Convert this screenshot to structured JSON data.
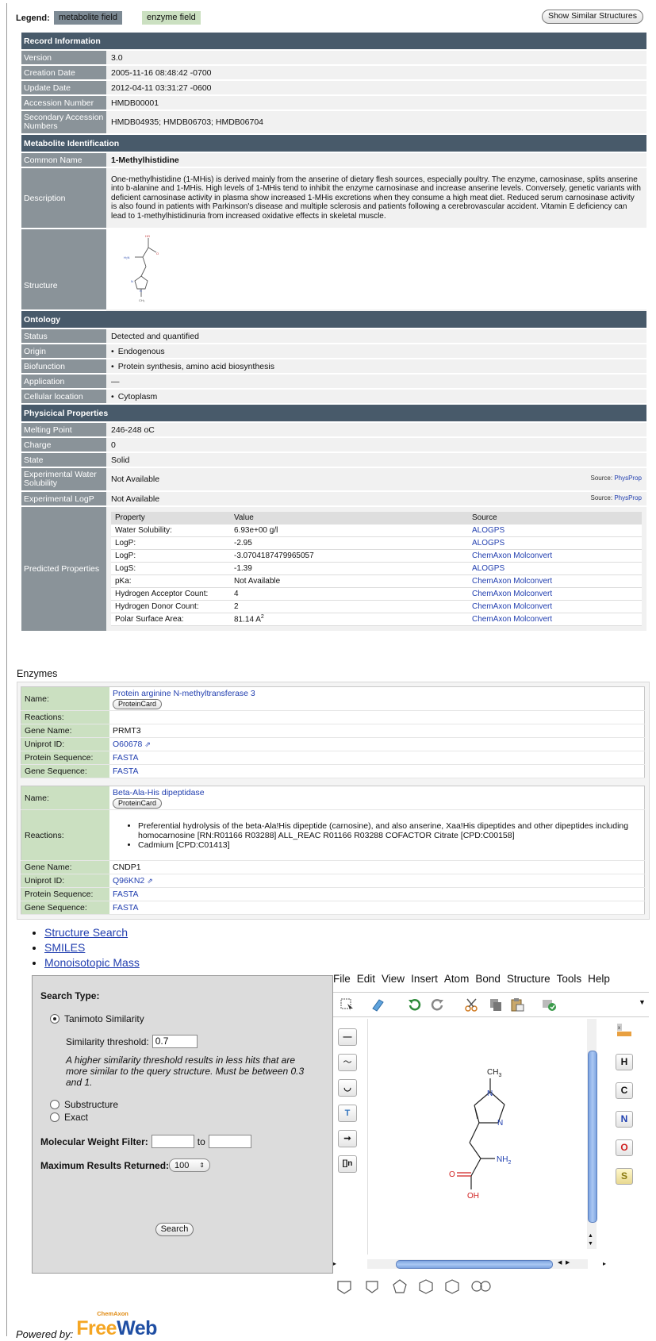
{
  "legend": {
    "label": "Legend:",
    "metabolite": "metabolite field",
    "enzyme": "enzyme field",
    "similar_button": "Show Similar Structures"
  },
  "record": {
    "section_record": "Record Information",
    "version_k": "Version",
    "version_v": "3.0",
    "creation_k": "Creation Date",
    "creation_v": "2005-11-16 08:48:42 -0700",
    "update_k": "Update Date",
    "update_v": "2012-04-11 03:31:27 -0600",
    "accession_k": "Accession Number",
    "accession_v": "HMDB00001",
    "secondary_k": "Secondary Accession Numbers",
    "secondary_v": "HMDB04935; HMDB06703; HMDB06704",
    "section_ident": "Metabolite Identification",
    "common_k": "Common Name",
    "common_v": "1-Methylhistidine",
    "description_k": "Description",
    "description_v": "One-methylhistidine (1-MHis) is derived mainly from the anserine of dietary flesh sources, especially poultry. The enzyme, carnosinase, splits anserine into b-alanine and 1-MHis. High levels of 1-MHis tend to inhibit the enzyme carnosinase and increase anserine levels. Conversely, genetic variants with deficient carnosinase activity in plasma show increased 1-MHis excretions when they consume a high meat diet. Reduced serum carnosinase activity is also found in patients with Parkinson's disease and multiple sclerosis and patients following a cerebrovascular accident. Vitamin E deficiency can lead to 1-methylhistidinuria from increased oxidative effects in skeletal muscle.",
    "structure_k": "Structure",
    "section_ontology": "Ontology",
    "status_k": "Status",
    "status_v": "Detected and quantified",
    "origin_k": "Origin",
    "origin_v": "Endogenous",
    "biofunction_k": "Biofunction",
    "biofunction_v": "Protein synthesis, amino acid biosynthesis",
    "application_k": "Application",
    "application_v": "—",
    "cellular_k": "Cellular location",
    "cellular_v": "Cytoplasm",
    "section_physical": "Physicical Properties",
    "melting_k": "Melting Point",
    "melting_v": "246-248 oC",
    "charge_k": "Charge",
    "charge_v": "0",
    "state_k": "State",
    "state_v": "Solid",
    "water_k": "Experimental Water Solubility",
    "water_v": "Not Available",
    "logp_k": "Experimental LogP",
    "logp_v": "Not Available",
    "source_label": "Source:",
    "source_link": "PhysProp",
    "predicted_k": "Predicted Properties"
  },
  "predicted": {
    "headers": [
      "Property",
      "Value",
      "Source"
    ],
    "rows": [
      [
        "Water Solubility:",
        "6.93e+00 g/l",
        "ALOGPS"
      ],
      [
        "LogP:",
        "-2.95",
        "ALOGPS"
      ],
      [
        "LogP:",
        "-3.0704187479965057",
        "ChemAxon Molconvert"
      ],
      [
        "LogS:",
        "-1.39",
        "ALOGPS"
      ],
      [
        "pKa:",
        "Not Available",
        "ChemAxon Molconvert"
      ],
      [
        "Hydrogen Acceptor Count:",
        "4",
        "ChemAxon Molconvert"
      ],
      [
        "Hydrogen Donor Count:",
        "2",
        "ChemAxon Molconvert"
      ],
      [
        "Polar Surface Area:",
        "81.14 A",
        "ChemAxon Molconvert"
      ]
    ],
    "psa_sup": "2"
  },
  "enzymes": {
    "title": "Enzymes",
    "labels": {
      "name": "Name:",
      "reactions": "Reactions:",
      "gene": "Gene Name:",
      "uniprot": "Uniprot ID:",
      "protein_seq": "Protein Sequence:",
      "gene_seq": "Gene Sequence:"
    },
    "protein_card": "ProteinCard",
    "e1": {
      "name": "Protein arginine N-methyltransferase 3",
      "gene": "PRMT3",
      "uniprot": "O60678",
      "protein_seq": "FASTA",
      "gene_seq": "FASTA"
    },
    "e2": {
      "name": "Beta-Ala-His dipeptidase",
      "reaction1": "Preferential hydrolysis of the beta-Ala!His dipeptide (carnosine), and also anserine, Xaa!His dipeptides and other dipeptides including homocarnosine [RN:R01166 R03288] ALL_REAC R01166 R03288 COFACTOR Citrate [CPD:C00158]",
      "reaction2": "Cadmium [CPD:C01413]",
      "gene": "CNDP1",
      "uniprot": "Q96KN2",
      "protein_seq": "FASTA",
      "gene_seq": "FASTA"
    }
  },
  "links": {
    "l1": "Structure Search",
    "l2": "SMILES",
    "l3": "Monoisotopic Mass"
  },
  "search": {
    "title": "Search Type:",
    "tanimoto": "Tanimoto Similarity",
    "threshold_label": "Similarity threshold:",
    "threshold_value": "0.7",
    "note": "A higher similarity threshold results in less hits that are more similar to the query structure. Must be between 0.3 and 1.",
    "substructure": "Substructure",
    "exact": "Exact",
    "mw_label": "Molecular Weight Filter:",
    "mw_to": "to",
    "max_label": "Maximum Results Returned:",
    "max_value": "100",
    "search_button": "Search"
  },
  "editor": {
    "menu": [
      "File",
      "Edit",
      "View",
      "Insert",
      "Atom",
      "Bond",
      "Structure",
      "Tools",
      "Help"
    ],
    "elements": [
      "H",
      "C",
      "N",
      "O",
      "S"
    ],
    "elements_colors": [
      "#111111",
      "#111111",
      "#1f3fb0",
      "#d02020",
      "#8a7a10"
    ],
    "molecule": {
      "ch3": "CH",
      "ch3_sub": "3",
      "n1": "N",
      "n2": "N",
      "nh2": "NH",
      "nh2_sub": "2",
      "o": "O",
      "oh": "OH"
    }
  },
  "footer": {
    "powered": "Powered by:",
    "brand_small": "ChemAxon",
    "brand_a": "Free",
    "brand_b": "Web"
  }
}
